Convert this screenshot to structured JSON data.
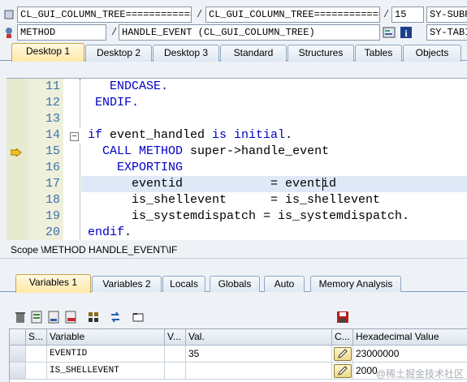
{
  "top_fields": {
    "row1_a": "CL_GUI_COLUMN_TREE=============",
    "row1_b": "CL_GUI_COLUMN_TREE=============",
    "row1_c": "15",
    "row1_d": "SY-SUBRC",
    "row2_a": "METHOD",
    "row2_b": "HANDLE_EVENT (CL_GUI_COLUMN_TREE)",
    "row2_d": "SY-TABIX",
    "sep": "/"
  },
  "desktop_tabs": [
    "Desktop 1",
    "Desktop 2",
    "Desktop 3",
    "Standard",
    "Structures",
    "Tables",
    "Objects"
  ],
  "code_lines": [
    {
      "n": "11",
      "t": "   ENDCASE.",
      "kw": true
    },
    {
      "n": "12",
      "t": " ENDIF.",
      "kw": true
    },
    {
      "n": "13",
      "t": ""
    },
    {
      "n": "14",
      "parts": [
        {
          "k": 1,
          "s": "if"
        },
        {
          "s": " event_handled "
        },
        {
          "k": 1,
          "s": "is initial"
        },
        {
          "s": "."
        }
      ]
    },
    {
      "n": "15",
      "parts": [
        {
          "s": "  "
        },
        {
          "k": 1,
          "s": "CALL METHOD"
        },
        {
          "s": " super->handle_event"
        }
      ]
    },
    {
      "n": "16",
      "parts": [
        {
          "s": "    "
        },
        {
          "k": 1,
          "s": "EXPORTING"
        }
      ]
    },
    {
      "n": "17",
      "t": "      eventid            = eventid"
    },
    {
      "n": "18",
      "t": "      is_shellevent      = is_shellevent"
    },
    {
      "n": "19",
      "t": "      is_systemdispatch = is_systemdispatch."
    },
    {
      "n": "20",
      "parts": [
        {
          "k": 1,
          "s": "endif"
        },
        {
          "s": "."
        }
      ]
    }
  ],
  "scope": "Scope \\METHOD HANDLE_EVENT\\IF",
  "var_tabs": [
    "Variables 1",
    "Variables 2",
    "Locals",
    "Globals",
    "Auto",
    "Memory Analysis"
  ],
  "grid": {
    "headers": [
      "S...",
      "Variable",
      "V...",
      "Val.",
      "C...",
      "Hexadecimal Value"
    ],
    "rows": [
      {
        "variable": "EVENTID",
        "value": "35",
        "hex": "23000000"
      },
      {
        "variable": "IS_SHELLEVENT",
        "value": "",
        "hex": "2000"
      }
    ]
  },
  "watermark": "@稀土掘金技术社区",
  "colors": {
    "accent_tab": "#ffe9a8",
    "keyword": "#0000c8",
    "line_number": "#3c6fa8",
    "highlight": "#dfe8f6"
  }
}
